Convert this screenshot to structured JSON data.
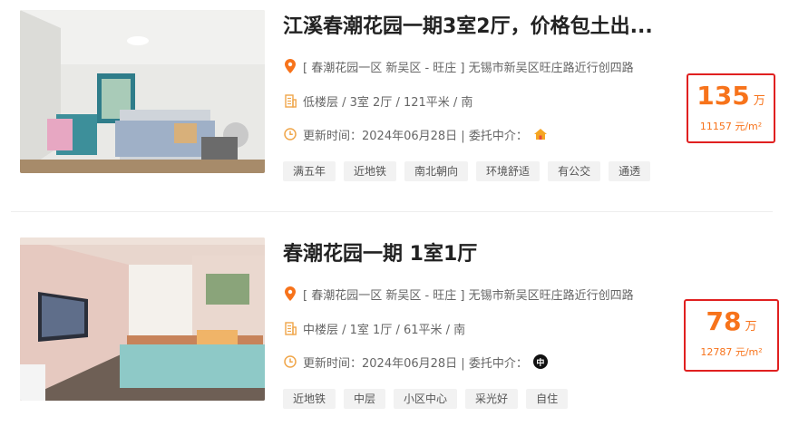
{
  "listings": [
    {
      "title": "江溪春潮花园一期3室2厅，价格包土出...",
      "location": "[ 春潮花园一区 新吴区 - 旺庄 ] 无锡市新吴区旺庄路近行创四路",
      "specs": "低楼层 / 3室 2厅 / 121平米 / 南",
      "updated": "更新时间：2024年06月28日 | 委托中介：",
      "agent_icon": "house-logo-icon",
      "agent_color": "#f5a623",
      "tags": [
        "满五年",
        "近地铁",
        "南北朝向",
        "环境舒适",
        "有公交",
        "通透"
      ],
      "price": "135",
      "price_unit": "万",
      "unit_price": "11157 元/m²"
    },
    {
      "title": "春潮花园一期 1室1厅",
      "location": "[ 春潮花园一区 新吴区 - 旺庄 ] 无锡市新吴区旺庄路近行创四路",
      "specs": "中楼层 / 1室 1厅 / 61平米 / 南",
      "updated": "更新时间：2024年06月28日 | 委托中介：",
      "agent_icon": "agent-logo-icon",
      "agent_mark": "中",
      "agent_color": "#111111",
      "tags": [
        "近地铁",
        "中层",
        "小区中心",
        "采光好",
        "自住"
      ],
      "price": "78",
      "price_unit": "万",
      "unit_price": "12787 元/m²"
    }
  ],
  "icons": {
    "location": "location-pin-icon",
    "specs": "building-icon",
    "updated": "clock-icon"
  },
  "colors": {
    "accent": "#f7731b",
    "highlight_border": "#e02020"
  }
}
